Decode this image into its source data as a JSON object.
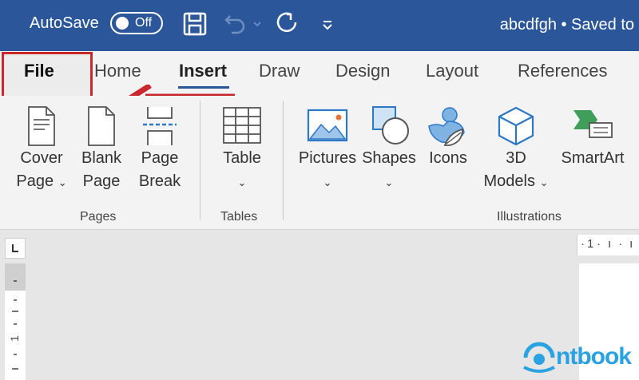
{
  "titlebar": {
    "autosave_label": "AutoSave",
    "autosave_state": "Off",
    "doc_status": "abcdfgh • Saved to"
  },
  "tabs": [
    "File",
    "Home",
    "Insert",
    "Draw",
    "Design",
    "Layout",
    "References"
  ],
  "active_tab": "Insert",
  "ribbon": {
    "pages": {
      "label": "Pages",
      "cover_page": [
        "Cover",
        "Page"
      ],
      "blank_page": [
        "Blank",
        "Page"
      ],
      "page_break": [
        "Page",
        "Break"
      ]
    },
    "tables": {
      "label": "Tables",
      "table": "Table"
    },
    "illustrations": {
      "label": "Illustrations",
      "pictures": "Pictures",
      "shapes": "Shapes",
      "icons": "Icons",
      "models_3d": [
        "3D",
        "Models"
      ],
      "smartart": "SmartArt"
    }
  },
  "ruler": {
    "mark": "1"
  },
  "watermark": "ntbook",
  "colors": {
    "titlebar": "#2b579a",
    "highlight": "#c9282d"
  }
}
